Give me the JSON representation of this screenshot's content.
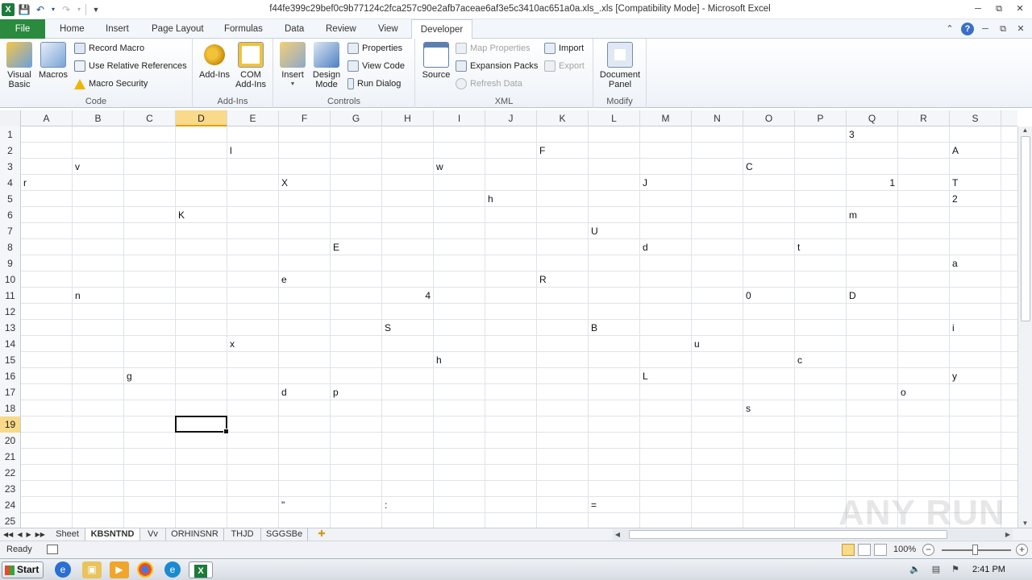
{
  "window": {
    "title": "f44fe399c29bef0c9b77124c2fca257c90e2afb7aceae6af3e5c3410ac651a0a.xls_.xls  [Compatibility Mode] - Microsoft Excel",
    "app_icon": "X"
  },
  "ribbon": {
    "tabs": [
      "File",
      "Home",
      "Insert",
      "Page Layout",
      "Formulas",
      "Data",
      "Review",
      "View",
      "Developer"
    ],
    "active_tab": "Developer",
    "groups": {
      "code": {
        "label": "Code",
        "visual_basic": "Visual\nBasic",
        "macros": "Macros",
        "record_macro": "Record Macro",
        "use_relative": "Use Relative References",
        "macro_security": "Macro Security"
      },
      "addins": {
        "label": "Add-Ins",
        "addins": "Add-Ins",
        "com_addins": "COM\nAdd-Ins"
      },
      "controls": {
        "label": "Controls",
        "insert": "Insert",
        "design_mode": "Design\nMode",
        "properties": "Properties",
        "view_code": "View Code",
        "run_dialog": "Run Dialog"
      },
      "xml": {
        "label": "XML",
        "source": "Source",
        "map_properties": "Map Properties",
        "expansion_packs": "Expansion Packs",
        "refresh_data": "Refresh Data",
        "import": "Import",
        "export": "Export"
      },
      "modify": {
        "label": "Modify",
        "document_panel": "Document\nPanel"
      }
    }
  },
  "grid": {
    "columns": [
      "A",
      "B",
      "C",
      "D",
      "E",
      "F",
      "G",
      "H",
      "I",
      "J",
      "K",
      "L",
      "M",
      "N",
      "O",
      "P",
      "Q",
      "R",
      "S"
    ],
    "rows": [
      "1",
      "2",
      "3",
      "4",
      "5",
      "6",
      "7",
      "8",
      "9",
      "10",
      "11",
      "12",
      "13",
      "14",
      "15",
      "16",
      "17",
      "18",
      "19",
      "20",
      "21",
      "22",
      "23",
      "24",
      "25"
    ],
    "selected_column": "D",
    "selected_row": "19",
    "cells": [
      {
        "col": "Q",
        "row": "1",
        "v": "3"
      },
      {
        "col": "E",
        "row": "2",
        "v": "l"
      },
      {
        "col": "K",
        "row": "2",
        "v": "F"
      },
      {
        "col": "S",
        "row": "2",
        "v": "A"
      },
      {
        "col": "B",
        "row": "3",
        "v": "v"
      },
      {
        "col": "I",
        "row": "3",
        "v": "w"
      },
      {
        "col": "O",
        "row": "3",
        "v": "C"
      },
      {
        "col": "A",
        "row": "4",
        "v": "r"
      },
      {
        "col": "F",
        "row": "4",
        "v": "X"
      },
      {
        "col": "M",
        "row": "4",
        "v": "J"
      },
      {
        "col": "Q",
        "row": "4",
        "v": "1",
        "align": "right"
      },
      {
        "col": "S",
        "row": "4",
        "v": "T",
        "overflow": true
      },
      {
        "col": "J",
        "row": "5",
        "v": "h"
      },
      {
        "col": "S",
        "row": "5",
        "v": "2"
      },
      {
        "col": "D",
        "row": "6",
        "v": "K"
      },
      {
        "col": "Q",
        "row": "6",
        "v": "m"
      },
      {
        "col": "L",
        "row": "7",
        "v": "U"
      },
      {
        "col": "G",
        "row": "8",
        "v": "E"
      },
      {
        "col": "M",
        "row": "8",
        "v": "d"
      },
      {
        "col": "P",
        "row": "8",
        "v": "t"
      },
      {
        "col": "S",
        "row": "9",
        "v": "a",
        "overflow": true
      },
      {
        "col": "F",
        "row": "10",
        "v": "e"
      },
      {
        "col": "K",
        "row": "10",
        "v": "R"
      },
      {
        "col": "B",
        "row": "11",
        "v": "n"
      },
      {
        "col": "H",
        "row": "11",
        "v": "4",
        "align": "right"
      },
      {
        "col": "O",
        "row": "11",
        "v": "0"
      },
      {
        "col": "Q",
        "row": "11",
        "v": "D"
      },
      {
        "col": "H",
        "row": "13",
        "v": "S"
      },
      {
        "col": "L",
        "row": "13",
        "v": "B"
      },
      {
        "col": "S",
        "row": "13",
        "v": "i"
      },
      {
        "col": "E",
        "row": "14",
        "v": "x"
      },
      {
        "col": "N",
        "row": "14",
        "v": "u"
      },
      {
        "col": "I",
        "row": "15",
        "v": "h"
      },
      {
        "col": "P",
        "row": "15",
        "v": "c"
      },
      {
        "col": "C",
        "row": "16",
        "v": "g"
      },
      {
        "col": "M",
        "row": "16",
        "v": "L"
      },
      {
        "col": "S",
        "row": "16",
        "v": "y",
        "overflow": true
      },
      {
        "col": "F",
        "row": "17",
        "v": "d"
      },
      {
        "col": "G",
        "row": "17",
        "v": "p"
      },
      {
        "col": "R",
        "row": "17",
        "v": "o"
      },
      {
        "col": "O",
        "row": "18",
        "v": "s"
      },
      {
        "col": "F",
        "row": "24",
        "v": "\""
      },
      {
        "col": "H",
        "row": "24",
        "v": ":"
      },
      {
        "col": "L",
        "row": "24",
        "v": "="
      }
    ]
  },
  "sheets": {
    "tabs": [
      "Sheet",
      "KBSNTND",
      "Vv",
      "ORHINSNR",
      "THJD",
      "SGGSBe"
    ],
    "active": "KBSNTND"
  },
  "status": {
    "ready": "Ready",
    "zoom": "100%",
    "zoom_fraction": 0.5
  },
  "taskbar": {
    "start": "Start",
    "clock": "2:41 PM"
  },
  "watermark": "ANY RUN",
  "colors": {
    "file_tab": "#2a8a3e",
    "selection_header": "#f9d98a",
    "excel_green": "#1d7a3a"
  }
}
